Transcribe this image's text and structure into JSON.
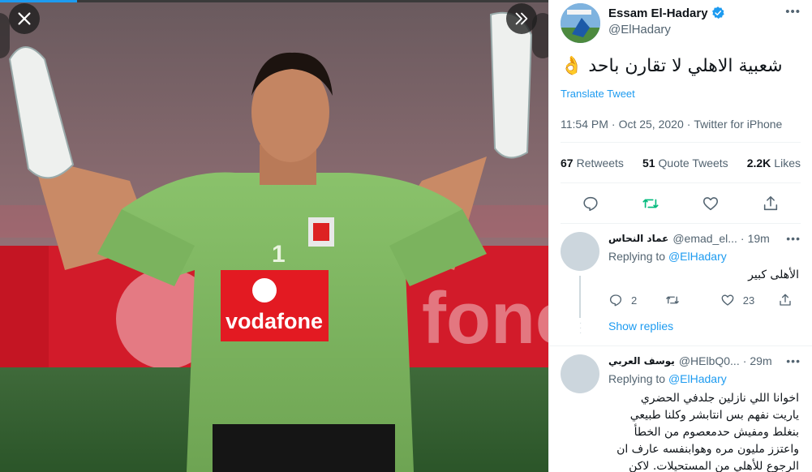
{
  "viewer": {
    "close_icon": "close-icon",
    "expand_icon": "chevron-double-right-icon"
  },
  "tweet": {
    "author_name": "Essam El-Hadary",
    "author_handle": "@ElHadary",
    "verified": true,
    "more_label": "•••",
    "text": "شعبية الاهلي لا تقارن باحد 👌",
    "translate_label": "Translate Tweet",
    "time": "11:54 PM",
    "date": "Oct 25, 2020",
    "source": "Twitter for iPhone",
    "stats": {
      "retweets_count": "67",
      "retweets_label": "Retweets",
      "quotes_count": "51",
      "quotes_label": "Quote Tweets",
      "likes_count": "2.2K",
      "likes_label": "Likes"
    },
    "actions": [
      "reply-icon",
      "retweet-icon",
      "like-icon",
      "share-icon"
    ]
  },
  "replies": [
    {
      "name": "عماد النحاس",
      "handle": "@emad_el...",
      "time": "19m",
      "more": "•••",
      "replying_prefix": "Replying to ",
      "replying_to": "@ElHadary",
      "text": "الأهلى كبير",
      "reply_count": "2",
      "retweet_count": "",
      "like_count": "23",
      "show_replies": "Show replies"
    },
    {
      "name": "يوسف العربي",
      "handle": "@HElbQ0...",
      "time": "29m",
      "more": "•••",
      "replying_prefix": "Replying to ",
      "replying_to": "@ElHadary",
      "lines": [
        "اخوانا اللي نازلين جلدفي الحضري",
        "ياريت نفهم بس انتابشر وكلنا طبيعي",
        "بنغلط ومفيش حدمعصوم من الخطأ",
        "واعتزز مليون مره وهوابنفسه عارف ان",
        "الرجوع للأهلي من المستحيلات. لاكن"
      ]
    }
  ],
  "colors": {
    "accent": "#1d9bf0",
    "retweet_green": "#00ba7c",
    "secondary_text": "#536471"
  }
}
